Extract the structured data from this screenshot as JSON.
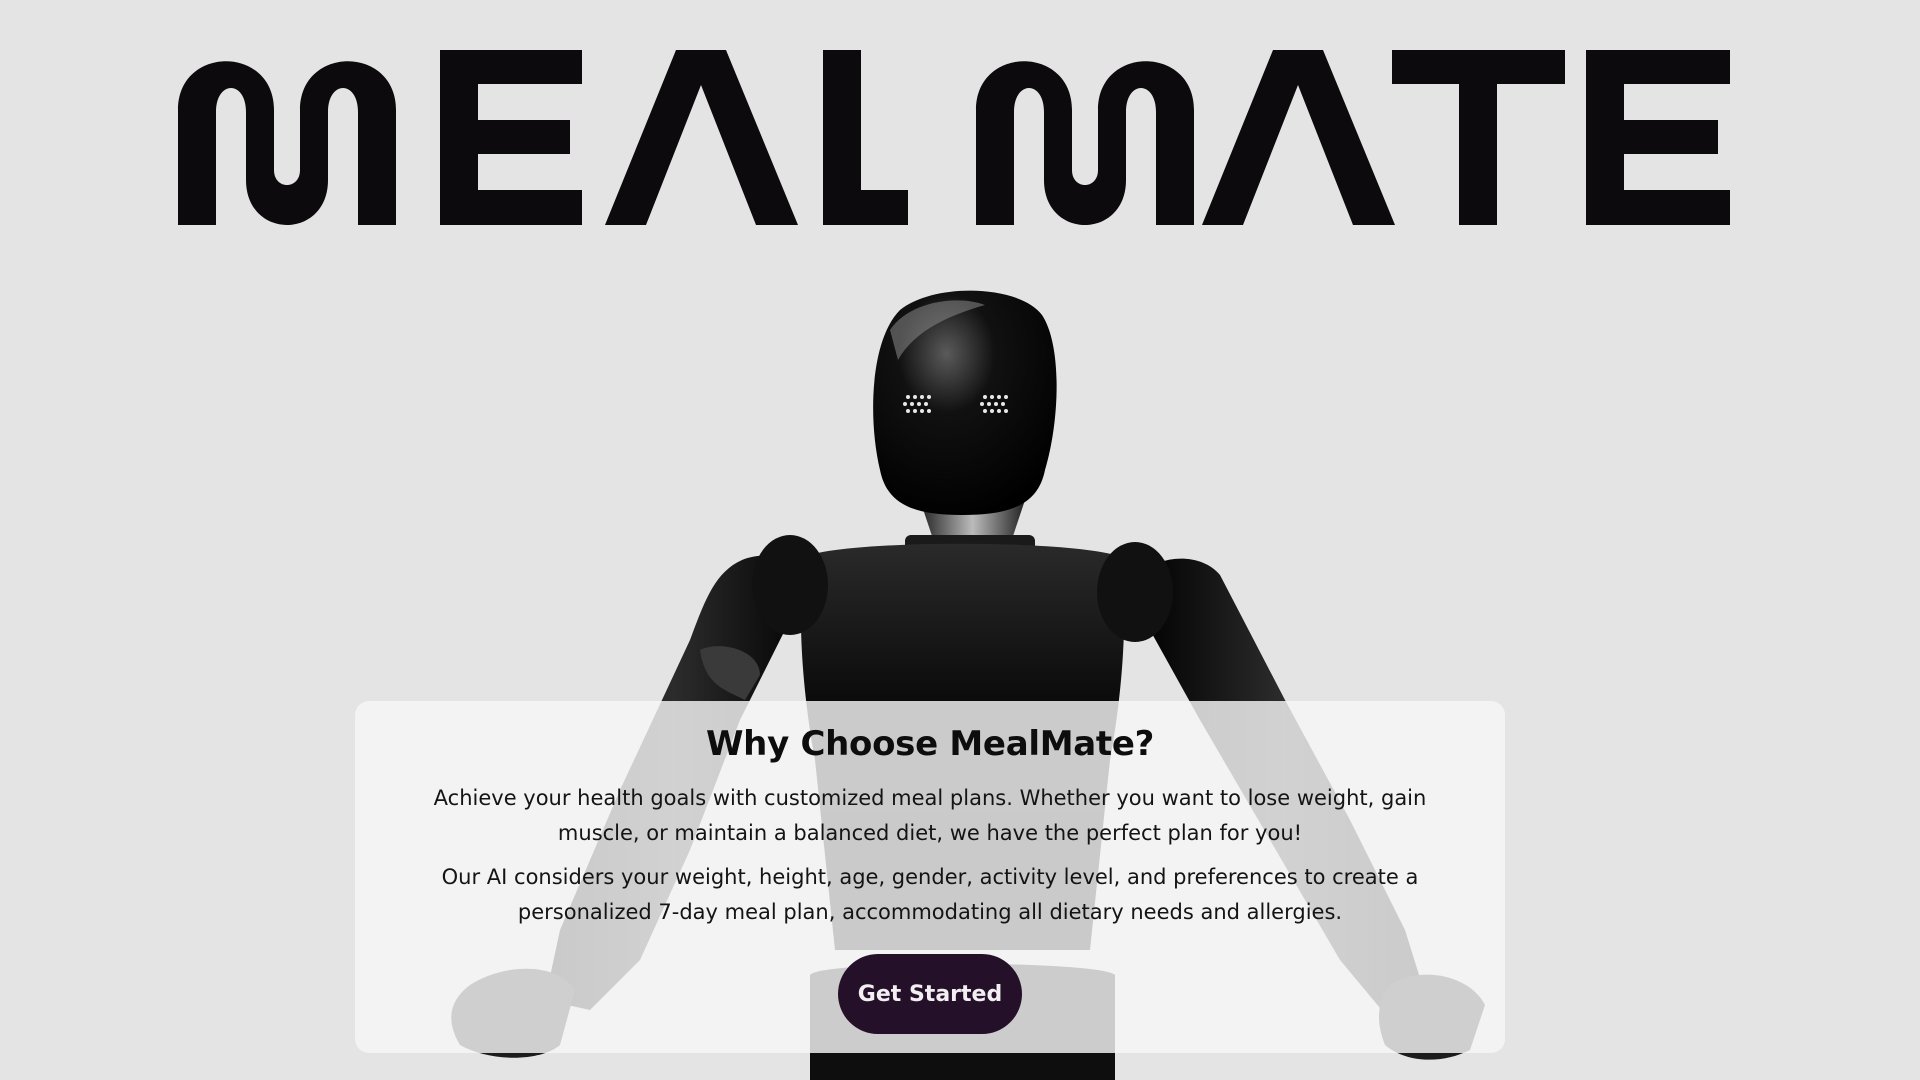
{
  "brand": {
    "name": "MEAL MATE"
  },
  "hero": {
    "image": "humanoid-robot-icon"
  },
  "card": {
    "title": "Why Choose MealMate?",
    "paragraph_1": "Achieve your health goals with customized meal plans. Whether you want to lose weight, gain muscle, or maintain a balanced diet, we have the perfect plan for you!",
    "paragraph_2": "Our AI considers your weight, height, age, gender, activity level, and preferences to create a personalized 7-day meal plan, accommodating all dietary needs and allergies.",
    "cta_label": "Get Started"
  },
  "colors": {
    "background": "#e4e4e4",
    "logo": "#0d0a0e",
    "cta_background": "#241028",
    "cta_text": "#f2eef2"
  }
}
